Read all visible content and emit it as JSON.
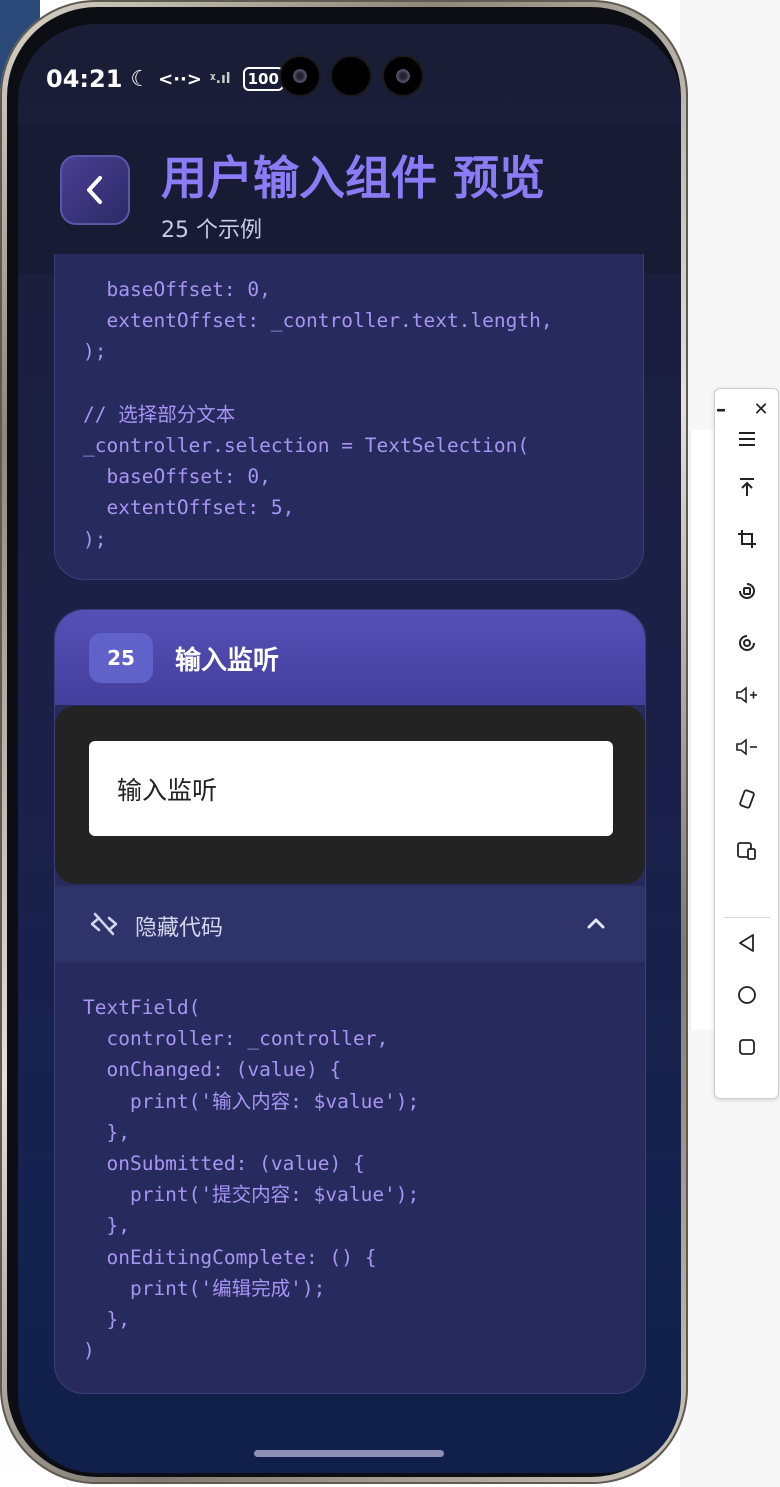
{
  "status_bar": {
    "time": "04:21",
    "moon": "☾",
    "code_symbol": "<··>",
    "signal": "ᵡ.ıl",
    "battery": "100"
  },
  "header": {
    "title": "用户输入组件 预览",
    "subtitle": "25 个示例"
  },
  "prev_card": {
    "code_lines": [
      "  baseOffset: 0,",
      "  extentOffset: _controller.text.length,",
      ");",
      "",
      "// 选择部分文本",
      "_controller.selection = TextSelection(",
      "  baseOffset: 0,",
      "  extentOffset: 5,",
      ");"
    ]
  },
  "card": {
    "badge": "25",
    "title": "输入监听",
    "input_value": "输入监听",
    "toggle_label": "隐藏代码",
    "code_lines": [
      "TextField(",
      "  controller: _controller,",
      "  onChanged: (value) {",
      "    print('输入内容: $value');",
      "  },",
      "  onSubmitted: (value) {",
      "    print('提交内容: $value');",
      "  },",
      "  onEditingComplete: () {",
      "    print('编辑完成');",
      "  },",
      ")"
    ]
  },
  "toolbar": {
    "minimize": "–",
    "close": "✕"
  },
  "colors": {
    "accent": "#8b7cf6",
    "code": "#a895f3",
    "card_header": "#5550b6"
  }
}
